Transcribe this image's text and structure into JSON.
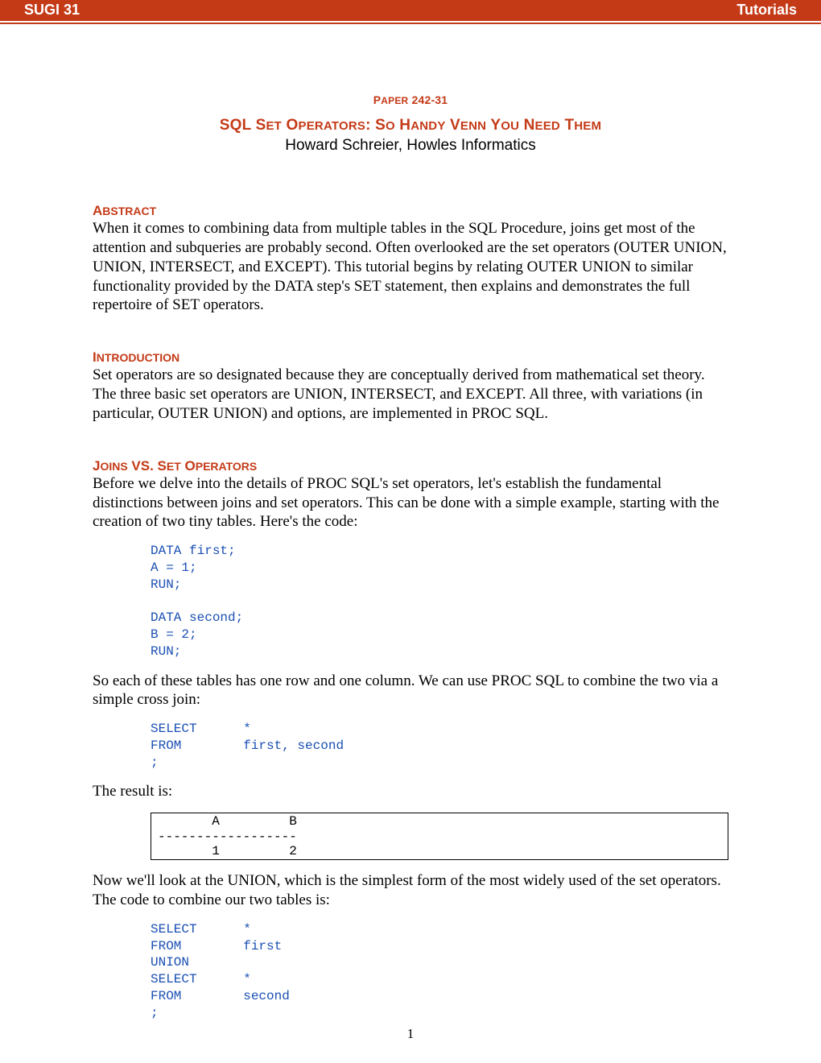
{
  "header": {
    "left": "SUGI 31",
    "right": "Tutorials"
  },
  "paper_label": {
    "p_cap": "P",
    "p_rest": "APER",
    "num": " 242-31"
  },
  "title_parts": [
    {
      "cap": "SQL S",
      "rest": "ET"
    },
    {
      "cap": " O",
      "rest": "PERATORS"
    },
    {
      "cap": ": S",
      "rest": "O"
    },
    {
      "cap": " H",
      "rest": "ANDY"
    },
    {
      "cap": " V",
      "rest": "ENN"
    },
    {
      "cap": " Y",
      "rest": "OU"
    },
    {
      "cap": " N",
      "rest": "EED"
    },
    {
      "cap": " T",
      "rest": "HEM"
    }
  ],
  "author": "Howard Schreier, Howles Informatics",
  "sections": {
    "abstract": {
      "h_cap": "A",
      "h_rest": "BSTRACT",
      "body": "When it comes to combining data from multiple tables in the SQL Procedure, joins get most of the attention and subqueries are probably second. Often overlooked are the set operators (OUTER UNION, UNION, INTERSECT, and EXCEPT). This tutorial begins by relating OUTER UNION to similar functionality provided by the DATA step's SET statement, then explains and demonstrates the full repertoire of SET operators."
    },
    "introduction": {
      "h_cap": "I",
      "h_rest": "NTRODUCTION",
      "body": "Set operators are so designated because they are conceptually derived from mathematical set theory. The three basic set operators are UNION, INTERSECT, and EXCEPT. All three, with variations (in particular, OUTER UNION) and options, are implemented in PROC SQL."
    },
    "joins": {
      "h1_cap": "J",
      "h1_rest": "OINS",
      "vs_cap": " VS. S",
      "vs_rest": "ET",
      "op_cap": " O",
      "op_rest": "PERATORS",
      "body1": "Before we delve into the details of PROC SQL's set operators, let's establish the fundamental distinctions between joins and set operators. This can be done with a simple example, starting with the creation of two tiny tables. Here's the code:",
      "code1": "DATA first;\nA = 1;\nRUN;\n\nDATA second;\nB = 2;\nRUN;",
      "body2": "So each of these tables has one row and one column. We can use PROC SQL to combine the two via a simple cross join:",
      "code2": "SELECT      *\nFROM        first, second\n;",
      "body3": "The result is:",
      "result": "       A         B\n------------------\n       1         2",
      "body4": "Now we'll look at the UNION, which is the simplest form of the most widely used of the set operators. The code to combine our two tables is:",
      "code3": "SELECT      *\nFROM        first\nUNION\nSELECT      *\nFROM        second\n;"
    }
  },
  "page_number": "1"
}
